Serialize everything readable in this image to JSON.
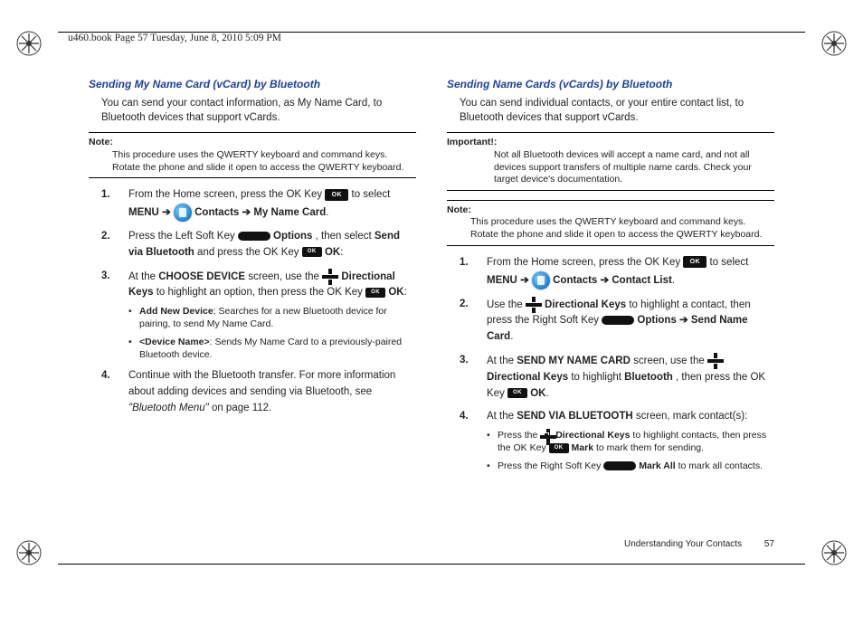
{
  "header": {
    "filepath_line": "u460.book  Page 57  Tuesday, June 8, 2010  5:09 PM"
  },
  "left": {
    "heading": "Sending My Name Card (vCard) by Bluetooth",
    "intro": "You can send your contact information, as My Name Card, to Bluetooth devices that support vCards.",
    "note_label": "Note:",
    "note_text": "This procedure uses the QWERTY keyboard and command keys. Rotate the phone and slide it open to access the QWERTY keyboard.",
    "s1_a": "From the Home screen, press the OK Key ",
    "s1_b": " to select ",
    "s1_menu": "MENU",
    "s1_arrow1": "  ➔  ",
    "s1_contacts": " Contacts ",
    "s1_arrow2": "➔",
    "s1_mycard": " My Name Card",
    "s2_a": "Press the Left Soft Key ",
    "s2_options": " Options",
    "s2_b": ", then select ",
    "s2_send": "Send via Bluetooth",
    "s2_c": " and press the OK Key ",
    "s2_ok": " OK",
    "s3_a": "At the ",
    "s3_screen": "CHOOSE DEVICE",
    "s3_b": " screen, use the ",
    "s3_dir": " Directional Keys",
    "s3_c": " to highlight an option, then press the OK Key ",
    "s3_ok": " OK",
    "b1_t": "Add New Device",
    "b1_d": ": Searches for a new Bluetooth device for pairing, to send My Name Card.",
    "b2_t": "<Device Name>",
    "b2_d": ": Sends My Name Card to a previously-paired Bluetooth device.",
    "s4_a": "Continue with the Bluetooth transfer. For more information about adding devices and sending via Bluetooth, see ",
    "s4_ref": "\"Bluetooth Menu\"",
    "s4_b": " on page 112."
  },
  "right": {
    "heading": "Sending Name Cards (vCards) by Bluetooth",
    "intro": "You can send individual contacts, or your entire contact list, to Bluetooth devices that support vCards.",
    "imp_label": "Important!:",
    "imp_text": "Not all Bluetooth devices will accept a name card, and not all devices support transfers of multiple name cards. Check your target device's documentation.",
    "note_label": "Note:",
    "note_text": "This procedure uses the QWERTY keyboard and command keys. Rotate the phone and slide it open to access the QWERTY keyboard.",
    "s1_a": "From the Home screen, press the OK Key ",
    "s1_b": " to select ",
    "s1_menu": "MENU",
    "s1_arrow1": " ➔ ",
    "s1_contacts": " Contacts ",
    "s1_arrow2": "➔",
    "s1_cl": " Contact List",
    "s2_a": "Use the ",
    "s2_dir": " Directional Keys",
    "s2_b": " to highlight a contact, then press the Right Soft Key ",
    "s2_opt": " Options ",
    "s2_arrow": "➔",
    "s2_send": " Send Name Card",
    "s3_a": "At the ",
    "s3_screen": "SEND MY NAME CARD",
    "s3_b": " screen, use the ",
    "s3_dir": " Directional Keys",
    "s3_c": " to highlight ",
    "s3_bt": "Bluetooth",
    "s3_d": ", then press the OK Key ",
    "s3_ok": " OK",
    "s4_a": "At the ",
    "s4_screen": "SEND VIA BLUETOOTH",
    "s4_b": " screen, mark contact(s):",
    "b1_a": "Press the ",
    "b1_dir": " Directional Keys",
    "b1_b": " to highlight contacts, then press the OK Key ",
    "b1_mark": " Mark",
    "b1_c": " to mark them for sending.",
    "b2_a": "Press the Right Soft Key ",
    "b2_mark": " Mark All",
    "b2_b": " to mark all contacts."
  },
  "footer": {
    "section": "Understanding Your Contacts",
    "page": "57"
  },
  "icons": {
    "ok_text": "OK"
  }
}
